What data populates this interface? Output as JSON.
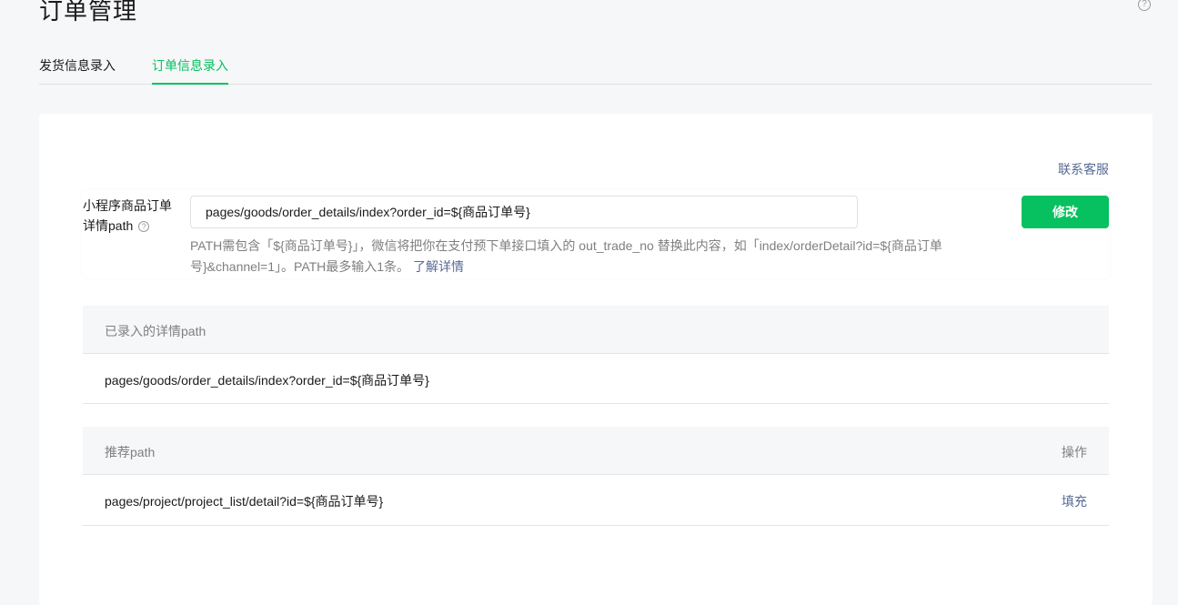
{
  "page": {
    "title": "订单管理",
    "help_icon": "?"
  },
  "tabs": [
    {
      "label": "发货信息录入",
      "active": false
    },
    {
      "label": "订单信息录入",
      "active": true
    }
  ],
  "card": {
    "contact_link": "联系客服",
    "form": {
      "label_line1": "小程序商品订单",
      "label_line2": "详情path",
      "label_icon": "?",
      "input_value": "pages/goods/order_details/index?order_id=${商品订单号}",
      "button_label": "修改",
      "hint_text": "PATH需包含「${商品订单号}」，微信将把你在支付预下单接口填入的 out_trade_no 替换此内容，如「index/orderDetail?id=${商品订单号}&channel=1」。PATH最多输入1条。",
      "hint_link": "了解详情"
    },
    "recorded_table": {
      "header": "已录入的详情path",
      "rows": [
        "pages/goods/order_details/index?order_id=${商品订单号}"
      ]
    },
    "recommended_table": {
      "header_path": "推荐path",
      "header_action": "操作",
      "rows": [
        {
          "path": "pages/project/project_list/detail?id=${商品订单号}",
          "action": "填充"
        }
      ]
    }
  },
  "colors": {
    "accent": "#07c160",
    "link": "#576b95"
  }
}
